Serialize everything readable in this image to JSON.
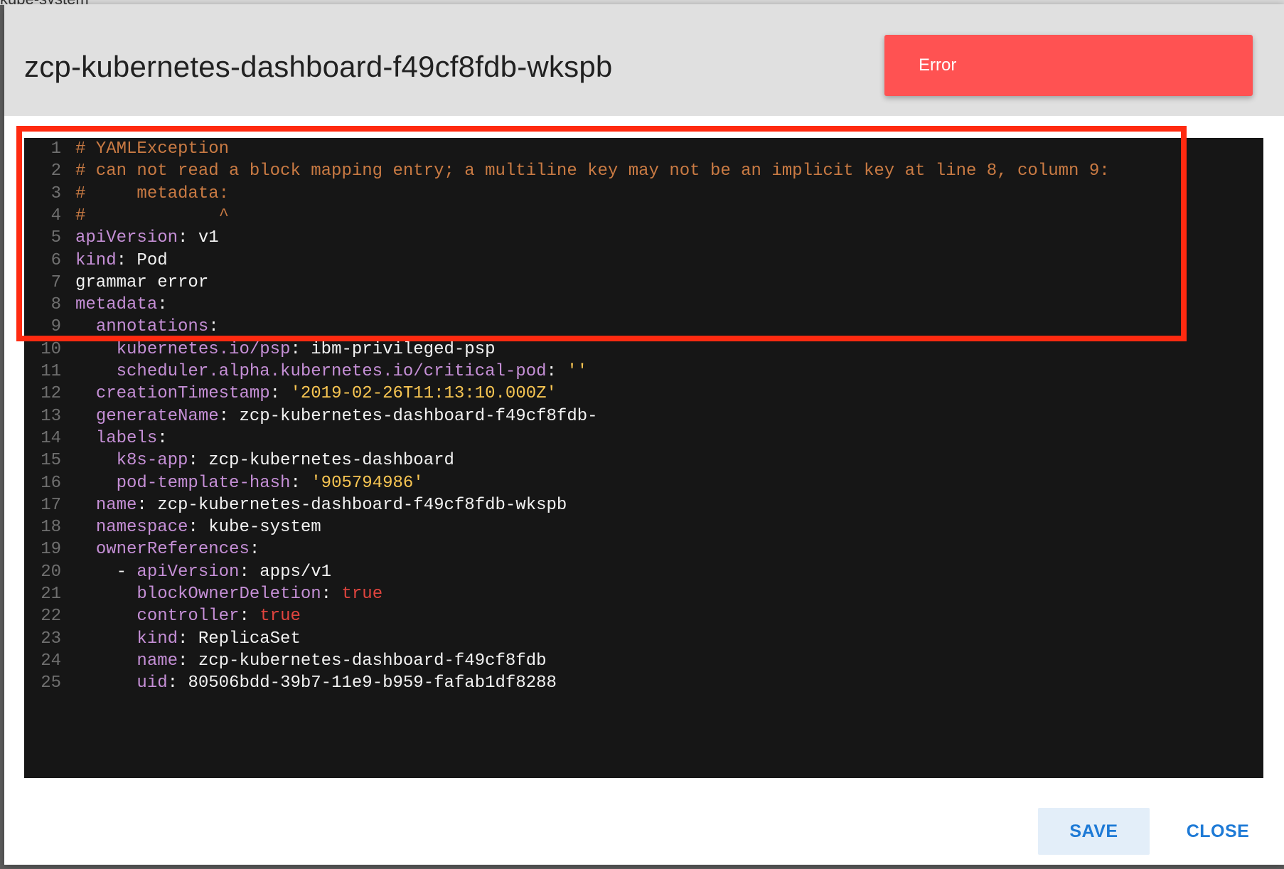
{
  "background": {
    "text": "kube-system"
  },
  "dialog": {
    "title": "zcp-kubernetes-dashboard-f49cf8fdb-wkspb",
    "toast": {
      "text": "Error",
      "color": "#ff5252"
    },
    "buttons": {
      "save": "SAVE",
      "close": "CLOSE"
    },
    "accent_color": "#1e7ad6",
    "highlight_color": "#ff2a10"
  },
  "editor": {
    "lines": [
      {
        "n": "1",
        "tokens": [
          {
            "t": "comment",
            "v": "# YAMLException"
          }
        ]
      },
      {
        "n": "2",
        "tokens": [
          {
            "t": "comment",
            "v": "# can not read a block mapping entry; a multiline key may not be an implicit key at line 8, column 9:"
          }
        ]
      },
      {
        "n": "3",
        "tokens": [
          {
            "t": "comment",
            "v": "#     metadata:"
          }
        ]
      },
      {
        "n": "4",
        "tokens": [
          {
            "t": "comment",
            "v": "#             ^"
          }
        ]
      },
      {
        "n": "5",
        "tokens": [
          {
            "t": "key",
            "v": "apiVersion"
          },
          {
            "t": "plain",
            "v": ": v1"
          }
        ]
      },
      {
        "n": "6",
        "tokens": [
          {
            "t": "key",
            "v": "kind"
          },
          {
            "t": "plain",
            "v": ": Pod"
          }
        ]
      },
      {
        "n": "7",
        "tokens": [
          {
            "t": "plain",
            "v": "grammar error"
          }
        ]
      },
      {
        "n": "8",
        "tokens": [
          {
            "t": "key",
            "v": "metadata"
          },
          {
            "t": "plain",
            "v": ":"
          }
        ]
      },
      {
        "n": "9",
        "tokens": [
          {
            "t": "plain",
            "v": "  "
          },
          {
            "t": "key",
            "v": "annotations"
          },
          {
            "t": "plain",
            "v": ":"
          }
        ]
      },
      {
        "n": "10",
        "tokens": [
          {
            "t": "plain",
            "v": "    "
          },
          {
            "t": "key",
            "v": "kubernetes.io/psp"
          },
          {
            "t": "plain",
            "v": ": ibm-privileged-psp"
          }
        ]
      },
      {
        "n": "11",
        "tokens": [
          {
            "t": "plain",
            "v": "    "
          },
          {
            "t": "key",
            "v": "scheduler.alpha.kubernetes.io/critical-pod"
          },
          {
            "t": "plain",
            "v": ": "
          },
          {
            "t": "string",
            "v": "''"
          }
        ]
      },
      {
        "n": "12",
        "tokens": [
          {
            "t": "plain",
            "v": "  "
          },
          {
            "t": "key",
            "v": "creationTimestamp"
          },
          {
            "t": "plain",
            "v": ": "
          },
          {
            "t": "string",
            "v": "'2019-02-26T11:13:10.000Z'"
          }
        ]
      },
      {
        "n": "13",
        "tokens": [
          {
            "t": "plain",
            "v": "  "
          },
          {
            "t": "key",
            "v": "generateName"
          },
          {
            "t": "plain",
            "v": ": zcp-kubernetes-dashboard-f49cf8fdb-"
          }
        ]
      },
      {
        "n": "14",
        "tokens": [
          {
            "t": "plain",
            "v": "  "
          },
          {
            "t": "key",
            "v": "labels"
          },
          {
            "t": "plain",
            "v": ":"
          }
        ]
      },
      {
        "n": "15",
        "tokens": [
          {
            "t": "plain",
            "v": "    "
          },
          {
            "t": "key",
            "v": "k8s-app"
          },
          {
            "t": "plain",
            "v": ": zcp-kubernetes-dashboard"
          }
        ]
      },
      {
        "n": "16",
        "tokens": [
          {
            "t": "plain",
            "v": "    "
          },
          {
            "t": "key",
            "v": "pod-template-hash"
          },
          {
            "t": "plain",
            "v": ": "
          },
          {
            "t": "string",
            "v": "'905794986'"
          }
        ]
      },
      {
        "n": "17",
        "tokens": [
          {
            "t": "plain",
            "v": "  "
          },
          {
            "t": "key",
            "v": "name"
          },
          {
            "t": "plain",
            "v": ": zcp-kubernetes-dashboard-f49cf8fdb-wkspb"
          }
        ]
      },
      {
        "n": "18",
        "tokens": [
          {
            "t": "plain",
            "v": "  "
          },
          {
            "t": "key",
            "v": "namespace"
          },
          {
            "t": "plain",
            "v": ": kube-system"
          }
        ]
      },
      {
        "n": "19",
        "tokens": [
          {
            "t": "plain",
            "v": "  "
          },
          {
            "t": "key",
            "v": "ownerReferences"
          },
          {
            "t": "plain",
            "v": ":"
          }
        ]
      },
      {
        "n": "20",
        "tokens": [
          {
            "t": "plain",
            "v": "    - "
          },
          {
            "t": "key",
            "v": "apiVersion"
          },
          {
            "t": "plain",
            "v": ": apps/v1"
          }
        ]
      },
      {
        "n": "21",
        "tokens": [
          {
            "t": "plain",
            "v": "      "
          },
          {
            "t": "key",
            "v": "blockOwnerDeletion"
          },
          {
            "t": "plain",
            "v": ": "
          },
          {
            "t": "bool",
            "v": "true"
          }
        ]
      },
      {
        "n": "22",
        "tokens": [
          {
            "t": "plain",
            "v": "      "
          },
          {
            "t": "key",
            "v": "controller"
          },
          {
            "t": "plain",
            "v": ": "
          },
          {
            "t": "bool",
            "v": "true"
          }
        ]
      },
      {
        "n": "23",
        "tokens": [
          {
            "t": "plain",
            "v": "      "
          },
          {
            "t": "key",
            "v": "kind"
          },
          {
            "t": "plain",
            "v": ": ReplicaSet"
          }
        ]
      },
      {
        "n": "24",
        "tokens": [
          {
            "t": "plain",
            "v": "      "
          },
          {
            "t": "key",
            "v": "name"
          },
          {
            "t": "plain",
            "v": ": zcp-kubernetes-dashboard-f49cf8fdb"
          }
        ]
      },
      {
        "n": "25",
        "tokens": [
          {
            "t": "plain",
            "v": "      "
          },
          {
            "t": "key",
            "v": "uid"
          },
          {
            "t": "plain",
            "v": ": 80506bdd-39b7-11e9-b959-fafab1df8288"
          }
        ]
      }
    ]
  }
}
